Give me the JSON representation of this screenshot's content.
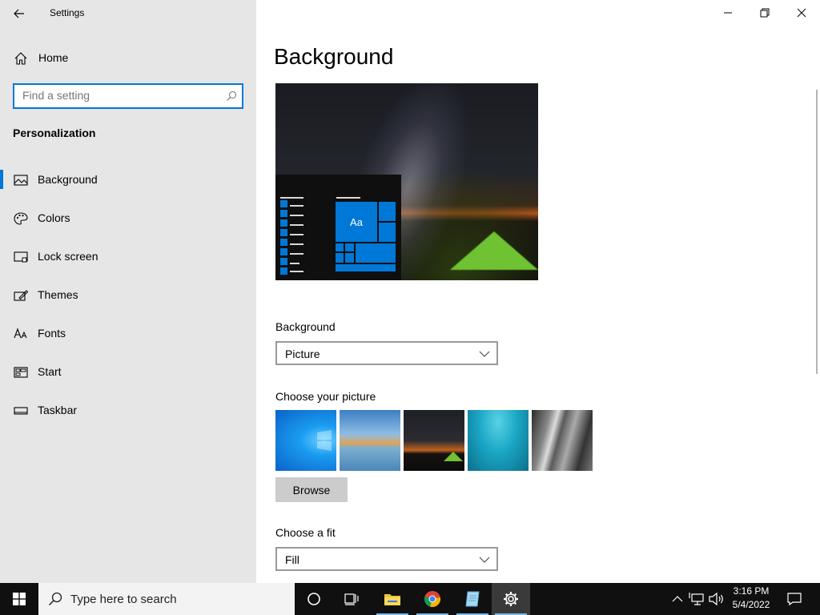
{
  "window": {
    "title": "Settings",
    "controls": [
      "minimize",
      "restore",
      "close"
    ]
  },
  "sidebar": {
    "home_label": "Home",
    "search_placeholder": "Find a setting",
    "section_title": "Personalization",
    "items": [
      {
        "label": "Background",
        "icon": "picture-icon",
        "active": true
      },
      {
        "label": "Colors",
        "icon": "palette-icon",
        "active": false
      },
      {
        "label": "Lock screen",
        "icon": "lock-screen-icon",
        "active": false
      },
      {
        "label": "Themes",
        "icon": "themes-icon",
        "active": false
      },
      {
        "label": "Fonts",
        "icon": "fonts-icon",
        "active": false
      },
      {
        "label": "Start",
        "icon": "start-icon",
        "active": false
      },
      {
        "label": "Taskbar",
        "icon": "taskbar-icon",
        "active": false
      }
    ]
  },
  "main": {
    "page_title": "Background",
    "preview_tile_text": "Aa",
    "background_label": "Background",
    "background_value": "Picture",
    "choose_picture_label": "Choose your picture",
    "browse_label": "Browse",
    "choose_fit_label": "Choose a fit",
    "fit_value": "Fill"
  },
  "taskbar": {
    "search_placeholder": "Type here to search",
    "apps": [
      "cortana-icon",
      "task-view-icon",
      "file-explorer-icon",
      "chrome-icon",
      "notepad-icon",
      "settings-icon"
    ],
    "time": "3:16 PM",
    "date": "5/4/2022"
  },
  "colors": {
    "accent": "#0078d7",
    "sidebar_bg": "#e6e6e6",
    "taskbar_bg": "#101010"
  }
}
